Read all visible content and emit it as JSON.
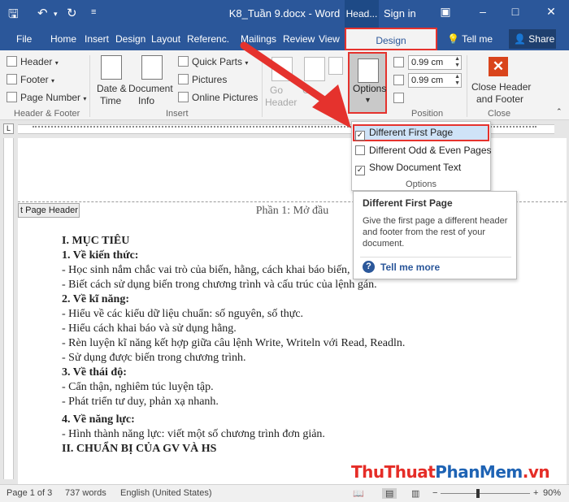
{
  "window": {
    "title": "K8_Tuần 9.docx - Word",
    "context_tab": "Head...",
    "sign_in": "Sign in"
  },
  "tabs": [
    "File",
    "Home",
    "Insert",
    "Design",
    "Layout",
    "Referenc...",
    "Mailings",
    "Review",
    "View"
  ],
  "active_tab": "Design",
  "tell_me": "Tell me",
  "share": "Share",
  "ribbon": {
    "header_footer": {
      "header": "Header",
      "footer": "Footer",
      "page_number": "Page Number",
      "label": "Header & Footer"
    },
    "insert": {
      "date_time_1": "Date &",
      "date_time_2": "Time",
      "doc_info_1": "Document",
      "doc_info_2": "Info",
      "quick_parts": "Quick Parts",
      "pictures": "Pictures",
      "online_pictures": "Online Pictures",
      "label": "Insert"
    },
    "navigation": {
      "goto_1": "Go",
      "goto_2": "Header",
      "goto_3": "G"
    },
    "options": {
      "label": "Options"
    },
    "position": {
      "top": "0.99 cm",
      "bottom": "0.99 cm",
      "label": "Position"
    },
    "close": {
      "line1": "Close Header",
      "line2": "and Footer",
      "label": "Close"
    }
  },
  "options_menu": {
    "items": [
      {
        "label": "Different First Page",
        "checked": true
      },
      {
        "label": "Different Odd & Even Pages",
        "checked": false
      },
      {
        "label": "Show Document Text",
        "checked": true
      }
    ],
    "group_label": "Options"
  },
  "tooltip": {
    "title": "Different First Page",
    "body": "Give the first page a different header and footer from the rest of your document.",
    "link": "Tell me more"
  },
  "document": {
    "header_tag": "t Page Header",
    "header_text": "Phần 1: Mở đầu",
    "lines": [
      {
        "text": "I. MỤC TIÊU",
        "bold": true
      },
      {
        "text": "1. Về kiến thức:",
        "bold": true
      },
      {
        "text": "- Học sinh nắm chắc vai trò của biến, hằng, cách khai báo biến, hằng.",
        "bold": false
      },
      {
        "text": "- Biết cách sử dụng biến trong chương trình và cấu trúc của lệnh gán.",
        "bold": false
      },
      {
        "text": "2. Về kĩ năng:",
        "bold": true
      },
      {
        "text": "- Hiểu về các kiểu dữ liệu chuẩn: số nguyên, số thực.",
        "bold": false
      },
      {
        "text": "- Hiểu cách khai báo và sử dụng hằng.",
        "bold": false
      },
      {
        "text": "- Rèn luyện kĩ năng kết hợp giữa câu lệnh Write, Writeln với Read, Readln.",
        "bold": false
      },
      {
        "text": "- Sử dụng được biến trong chương trình.",
        "bold": false
      },
      {
        "text": "3. Về thái độ:",
        "bold": true
      },
      {
        "text": "- Cẩn thận, nghiêm túc luyện tập.",
        "bold": false
      },
      {
        "text": "- Phát triển tư duy, phản xạ nhanh.",
        "bold": false
      },
      {
        "text": "4. Về năng lực:",
        "bold": true
      },
      {
        "text": "- Hình thành năng lực: viết một số chương trình đơn giản.",
        "bold": false
      },
      {
        "text": "II. CHUẨN BỊ CỦA GV VÀ HS",
        "bold": true
      }
    ]
  },
  "status": {
    "page": "Page 1 of 3",
    "words": "737 words",
    "language": "English (United States)",
    "zoom": "90%"
  },
  "watermark": {
    "part1": "ThuThuat",
    "part2": "PhanMem",
    "part3": ".vn"
  },
  "colors": {
    "word_blue": "#2b579a",
    "highlight_red": "#e5322d",
    "watermark_red": "#e52d27",
    "watermark_blue": "#1e63b4"
  }
}
